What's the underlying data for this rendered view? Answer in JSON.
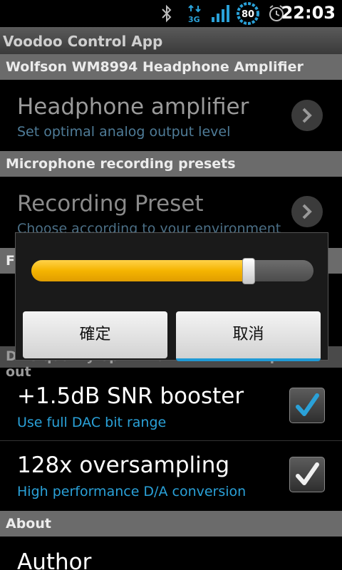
{
  "status_bar": {
    "time": "22:03",
    "battery_level": "80",
    "network_type": "3G",
    "icons": [
      "bluetooth-icon",
      "data-3g-icon",
      "signal-icon",
      "battery-icon",
      "alarm-icon"
    ]
  },
  "app": {
    "title": "Voodoo Control App"
  },
  "sections": {
    "amp": "Wolfson WM8994 Headphone Amplifier",
    "mic": "Microphone recording presets",
    "dac_partial": "F",
    "dac": "DAC quality optimizations on headphone out",
    "about": "About"
  },
  "preferences": {
    "headphone_amp": {
      "title": "Headphone amplifier",
      "summary": "Set optimal analog output level"
    },
    "recording_preset": {
      "title": "Recording Preset",
      "summary": "Choose according to your environment"
    },
    "snr_booster": {
      "title": "+1.5dB SNR booster",
      "summary": "Use full DAC bit range",
      "checked": true
    },
    "oversampling": {
      "title": "128x oversampling",
      "summary": "High performance D/A conversion",
      "checked": true
    },
    "author": {
      "title": "Author"
    }
  },
  "dialog": {
    "slider_fraction": 0.77,
    "confirm_label": "確定",
    "cancel_label": "取消"
  },
  "colors": {
    "accent_blue": "#2aa1d8",
    "slider_fill": "#f5b400",
    "section_bg": "#6b6b6b"
  }
}
